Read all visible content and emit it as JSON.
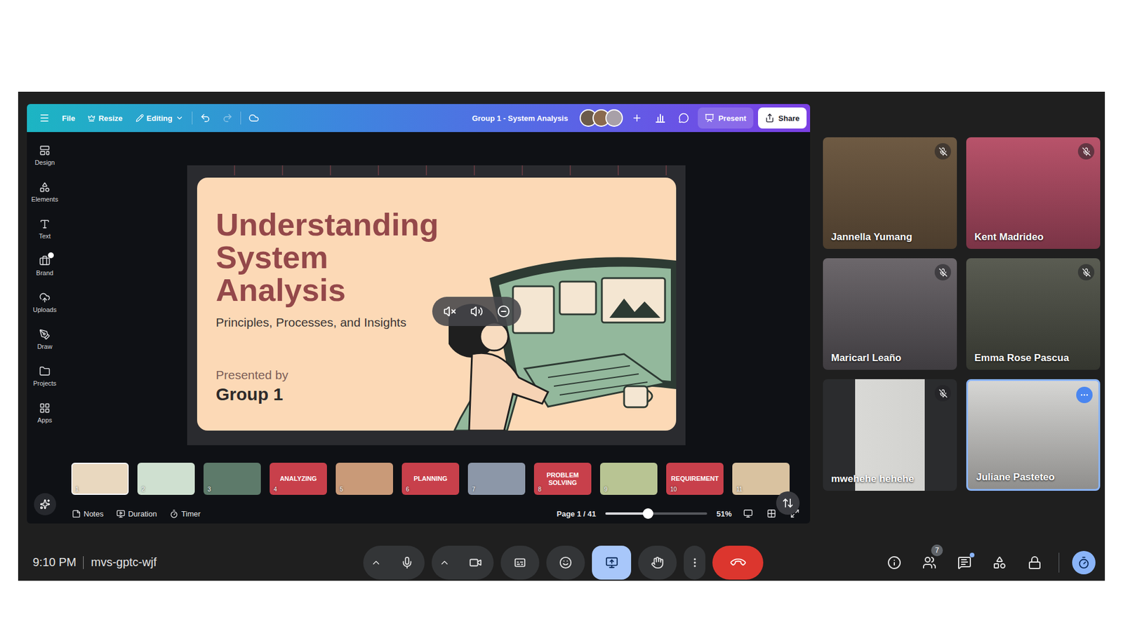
{
  "canva": {
    "header": {
      "file": "File",
      "resize": "Resize",
      "mode": "Editing",
      "title": "Group 1 - System Analysis",
      "present": "Present",
      "share": "Share"
    },
    "sidebar": [
      {
        "label": "Design"
      },
      {
        "label": "Elements"
      },
      {
        "label": "Text"
      },
      {
        "label": "Brand"
      },
      {
        "label": "Uploads"
      },
      {
        "label": "Draw"
      },
      {
        "label": "Projects"
      },
      {
        "label": "Apps"
      }
    ],
    "slide": {
      "title": [
        "Understanding",
        "System",
        "Analysis"
      ],
      "subtitle": "Principles, Processes, and Insights",
      "presented_by": "Presented by",
      "group": "Group 1"
    },
    "thumbnails": [
      {
        "number": "1",
        "label": "",
        "kind": "image",
        "selected": true
      },
      {
        "number": "2",
        "label": "",
        "kind": "image",
        "selected": false
      },
      {
        "number": "3",
        "label": "",
        "kind": "image",
        "selected": false
      },
      {
        "number": "4",
        "label": "ANALYZING",
        "kind": "title",
        "selected": false
      },
      {
        "number": "5",
        "label": "",
        "kind": "image",
        "selected": false
      },
      {
        "number": "6",
        "label": "PLANNING",
        "kind": "title",
        "selected": false
      },
      {
        "number": "7",
        "label": "",
        "kind": "image",
        "selected": false
      },
      {
        "number": "8",
        "label": "PROBLEM SOLVING",
        "kind": "title",
        "selected": false
      },
      {
        "number": "9",
        "label": "",
        "kind": "image",
        "selected": false
      },
      {
        "number": "10",
        "label": "REQUIREMENT",
        "kind": "title",
        "selected": false
      },
      {
        "number": "11",
        "label": "",
        "kind": "image",
        "selected": false
      }
    ],
    "footer": {
      "notes": "Notes",
      "duration": "Duration",
      "timer": "Timer",
      "page": "Page 1 / 41",
      "zoom": {
        "level": 0.42,
        "reading": "51%"
      }
    }
  },
  "participants": [
    {
      "name": "Jannella Yumang",
      "muted": true,
      "selected": false
    },
    {
      "name": "Kent Madrideo",
      "muted": true,
      "selected": false
    },
    {
      "name": "Maricarl Leaño",
      "muted": true,
      "selected": false
    },
    {
      "name": "Emma Rose Pascua",
      "muted": true,
      "selected": false
    },
    {
      "name": "mwehehe hehehe",
      "muted": true,
      "selected": false
    },
    {
      "name": "Juliane Pasteteo",
      "muted": false,
      "selected": true
    }
  ],
  "meeting": {
    "time": "9:10 PM",
    "code": "mvs-gptc-wjf",
    "people_count": "7",
    "presenting": true,
    "chat_unread": true
  }
}
